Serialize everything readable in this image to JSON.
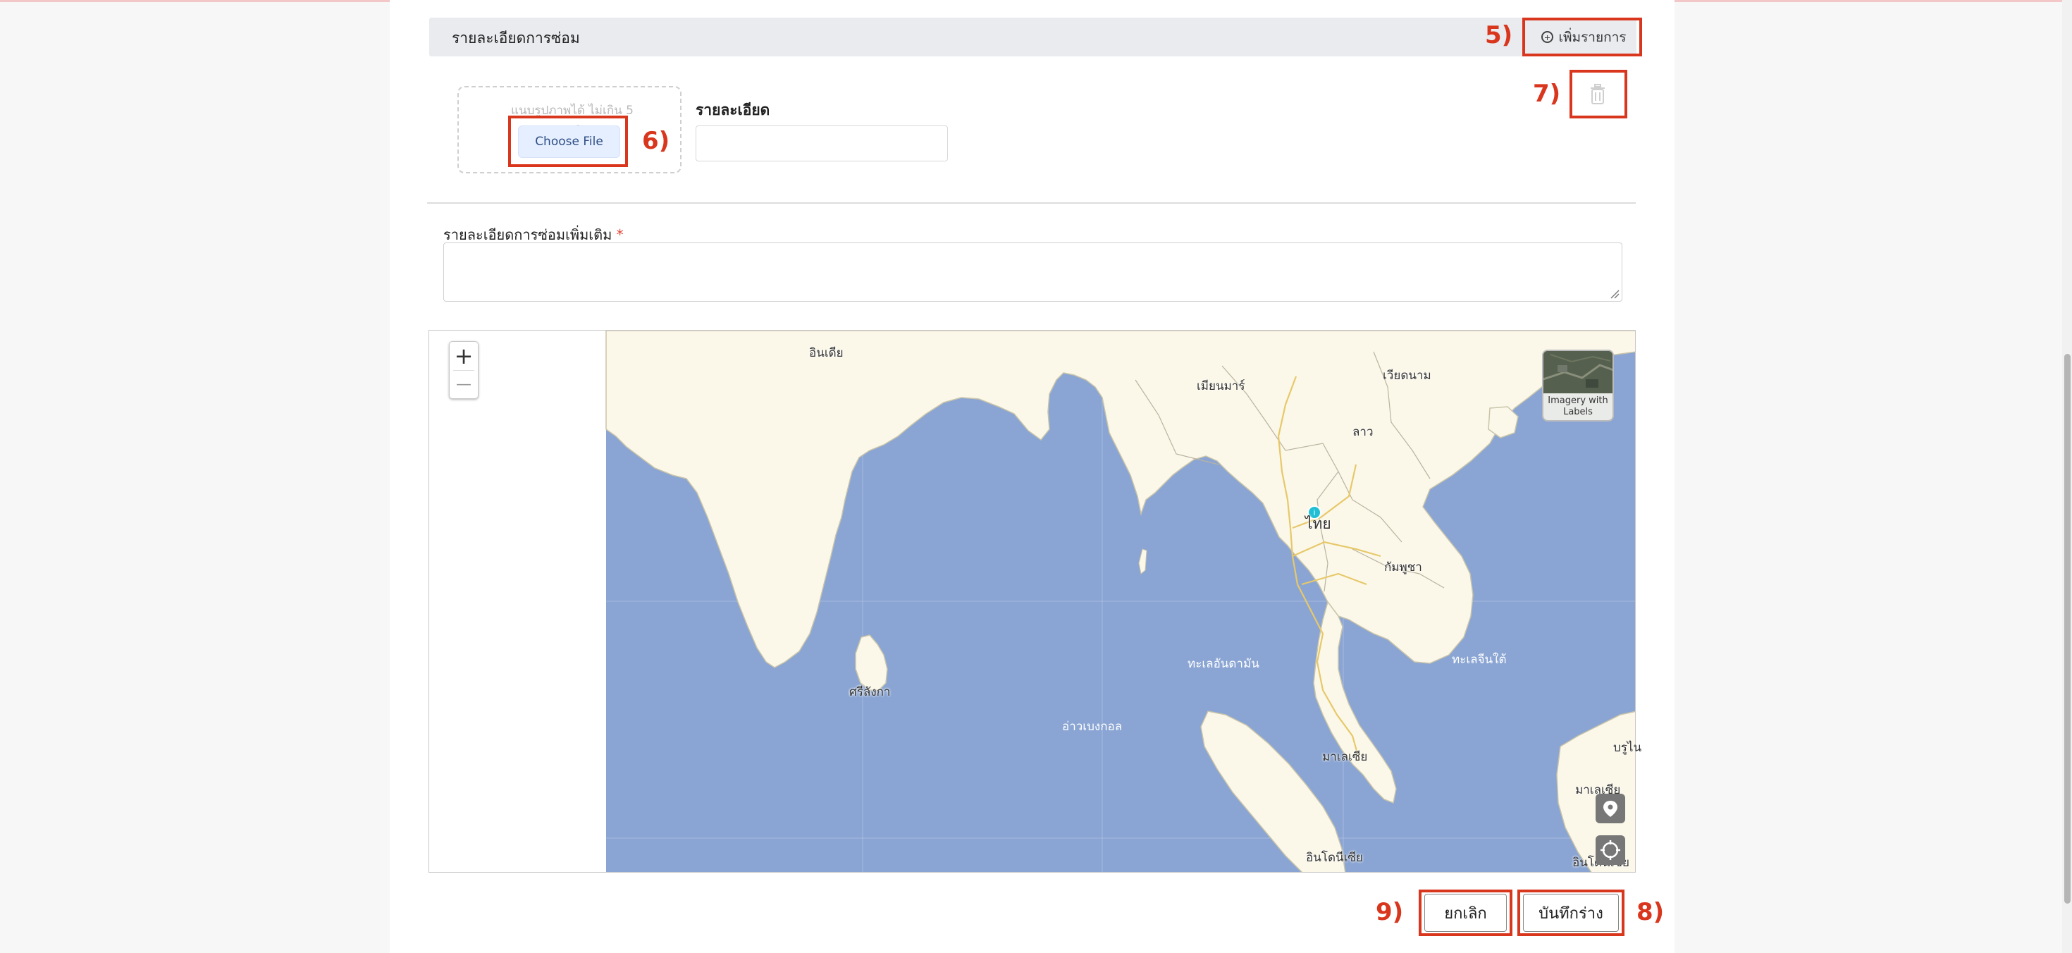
{
  "section": {
    "title": "รายละเอียดการซ่อม",
    "add_label": "เพิ่มรายการ"
  },
  "upload": {
    "hint": "แนบรูปภาพได้ ไม่เกิน 5 รูป",
    "choose_label": "Choose File"
  },
  "detail": {
    "label": "รายละเอียด",
    "value": "",
    "placeholder": ""
  },
  "extra": {
    "label": "รายละเอียดการซ่อมเพิ่มเติม",
    "required_mark": "*",
    "value": ""
  },
  "map": {
    "zoom_in": "+",
    "zoom_out": "—",
    "layer_label": "Imagery with Labels",
    "labels": {
      "india": "อินเดีย",
      "myanmar": "เมียนมาร์",
      "vietnam": "เวียดนาม",
      "laos": "ลาว",
      "thailand": "ไทย",
      "cambodia": "กัมพูชา",
      "sri_lanka": "ศรีลังกา",
      "andaman_sea": "ทะเลอันดามัน",
      "south_china_sea": "ทะเลจีนใต้",
      "bay_of_bengal": "อ่าวเบงกอล",
      "malaysia_1": "มาเลเซีย",
      "malaysia_2": "มาเลเซีย",
      "brunei": "บรูไน",
      "indonesia_1": "อินโดนีเซีย",
      "indonesia_2": "อินโดนีเซีย"
    }
  },
  "footer": {
    "cancel_label": "ยกเลิก",
    "save_draft_label": "บันทึกร่าง"
  },
  "annotations": {
    "a5": "5)",
    "a6": "6)",
    "a7": "7)",
    "a8": "8)",
    "a9": "9)"
  },
  "colors": {
    "annotation": "#d9361e",
    "sea": "#8aa5d3",
    "land": "#fbf8e9",
    "button_blue": "#e6efff"
  }
}
